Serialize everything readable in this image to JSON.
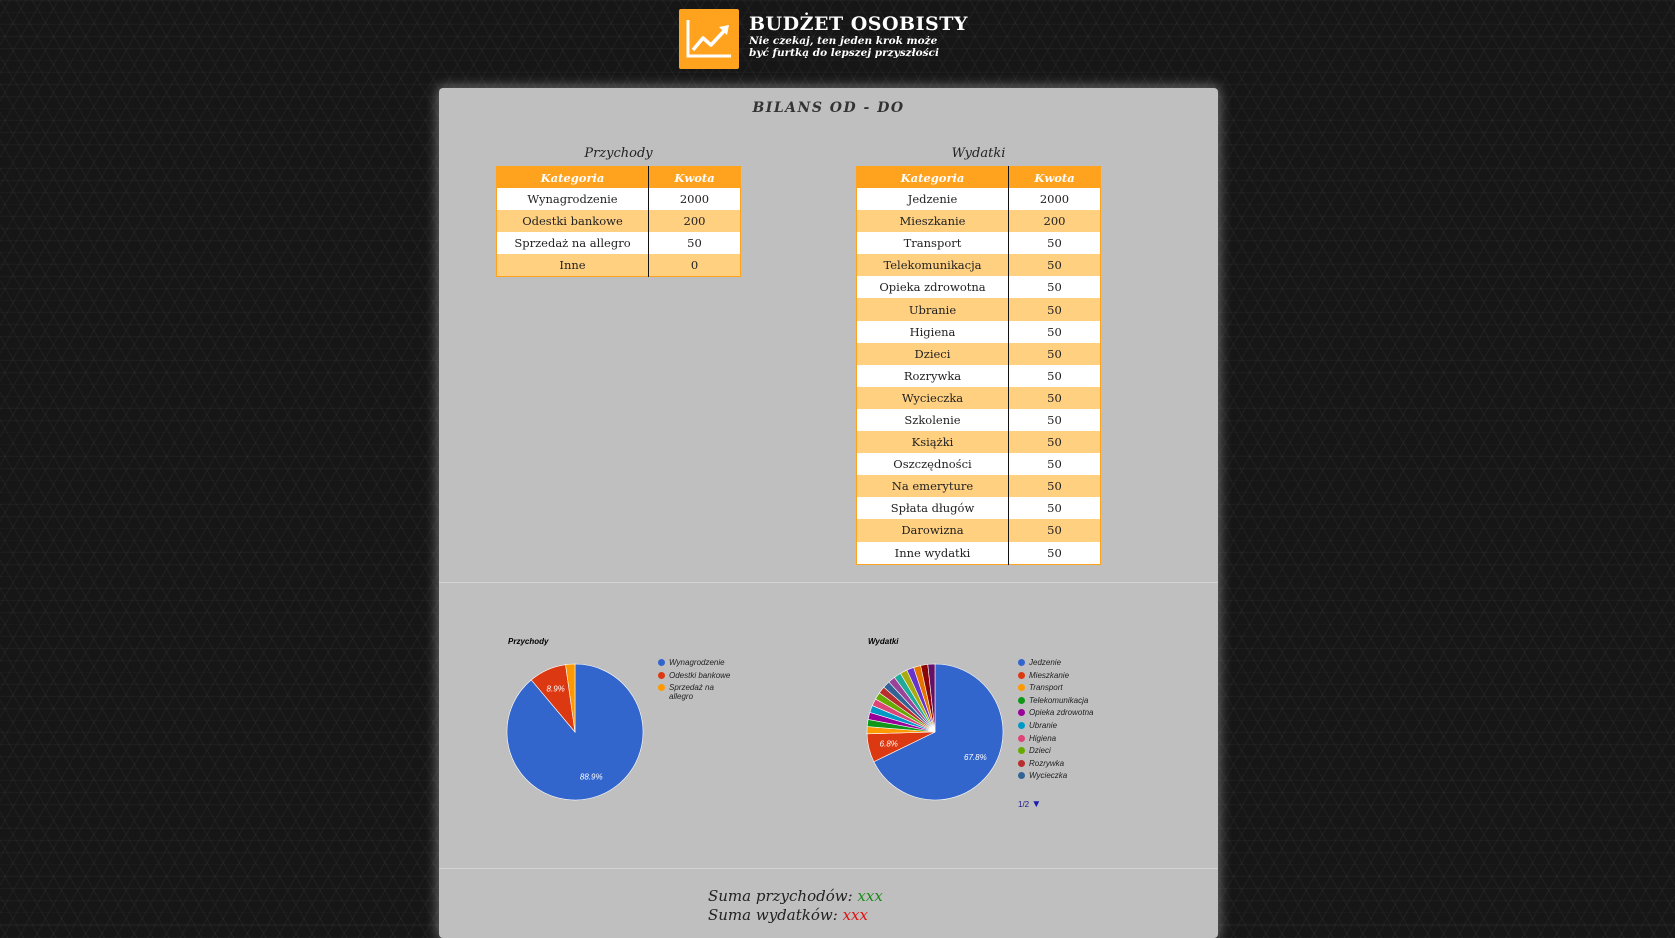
{
  "header": {
    "title": "BUDŻET OSOBISTY",
    "subtitle": "Nie czekaj, ten jeden krok może być furtką do lepszej przyszłości",
    "logo_icon": "trending-up-chart-icon",
    "accent_color": "#ffa31f"
  },
  "page": {
    "title": "BILANS OD - DO"
  },
  "income_table": {
    "caption": "Przychody",
    "headers": [
      "Kategoria",
      "Kwota"
    ],
    "rows": [
      [
        "Wynagrodzenie",
        "2000"
      ],
      [
        "Odestki bankowe",
        "200"
      ],
      [
        "Sprzedaż na allegro",
        "50"
      ],
      [
        "Inne",
        "0"
      ]
    ]
  },
  "expense_table": {
    "caption": "Wydatki",
    "headers": [
      "Kategoria",
      "Kwota"
    ],
    "rows": [
      [
        "Jedzenie",
        "2000"
      ],
      [
        "Mieszkanie",
        "200"
      ],
      [
        "Transport",
        "50"
      ],
      [
        "Telekomunikacja",
        "50"
      ],
      [
        "Opieka zdrowotna",
        "50"
      ],
      [
        "Ubranie",
        "50"
      ],
      [
        "Higiena",
        "50"
      ],
      [
        "Dzieci",
        "50"
      ],
      [
        "Rozrywka",
        "50"
      ],
      [
        "Wycieczka",
        "50"
      ],
      [
        "Szkolenie",
        "50"
      ],
      [
        "Książki",
        "50"
      ],
      [
        "Oszczędności",
        "50"
      ],
      [
        "Na emeryture",
        "50"
      ],
      [
        "Spłata długów",
        "50"
      ],
      [
        "Darowizna",
        "50"
      ],
      [
        "Inne wydatki",
        "50"
      ]
    ]
  },
  "chart_data": [
    {
      "type": "pie",
      "title": "Przychody",
      "categories": [
        "Wynagrodzenie",
        "Odestki bankowe",
        "Sprzedaż na allegro"
      ],
      "values": [
        2000,
        200,
        50
      ],
      "slice_labels": [
        "88.9%",
        "8.9%",
        ""
      ],
      "colors": [
        "#3366cc",
        "#dc3912",
        "#ff9900"
      ],
      "legend": "right"
    },
    {
      "type": "pie",
      "title": "Wydatki",
      "categories": [
        "Jedzenie",
        "Mieszkanie",
        "Transport",
        "Telekomunikacja",
        "Opieka zdrowotna",
        "Ubranie",
        "Higiena",
        "Dzieci",
        "Rozrywka",
        "Wycieczka",
        "Szkolenie",
        "Książki",
        "Oszczędności",
        "Na emeryture",
        "Spłata długów",
        "Darowizna",
        "Inne wydatki"
      ],
      "values": [
        2000,
        200,
        50,
        50,
        50,
        50,
        50,
        50,
        50,
        50,
        50,
        50,
        50,
        50,
        50,
        50,
        50
      ],
      "slice_labels": [
        "67.8%",
        "6.8%",
        "",
        "",
        "",
        "",
        "",
        "",
        "",
        "",
        "",
        "",
        "",
        "",
        "",
        "",
        ""
      ],
      "colors": [
        "#3366cc",
        "#dc3912",
        "#ff9900",
        "#109618",
        "#990099",
        "#0099c6",
        "#dd4477",
        "#66aa00",
        "#b82e2e",
        "#316395",
        "#994499",
        "#22aa99",
        "#aaaa11",
        "#6633cc",
        "#e67300",
        "#8b0707",
        "#651067"
      ],
      "legend": "right",
      "legend_visible_count": 10,
      "legend_page": "1/2"
    }
  ],
  "summary": {
    "income_label": "Suma przychodów:",
    "income_value": "xxx",
    "expense_label": "Suma wydatków:",
    "expense_value": "xxx",
    "income_color": "#1a8a1a",
    "expense_color": "#e01010"
  }
}
